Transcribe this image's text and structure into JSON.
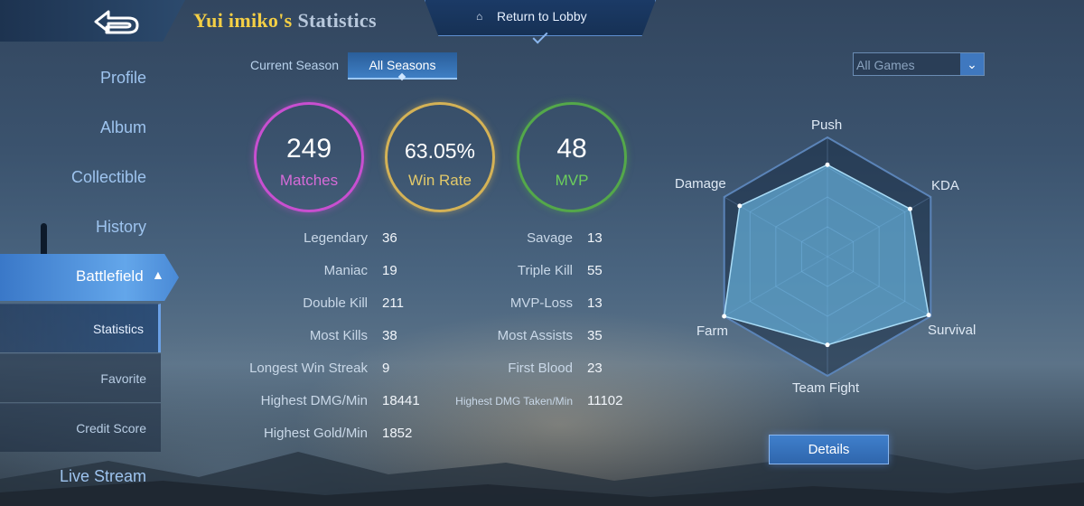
{
  "header": {
    "player_name": "Yui imiko's",
    "title_suffix": "Statistics",
    "lobby_label": "Return to Lobby"
  },
  "sidebar": {
    "items": [
      {
        "label": "Profile"
      },
      {
        "label": "Album"
      },
      {
        "label": "Collectible"
      },
      {
        "label": "History"
      },
      {
        "label": "Battlefield"
      },
      {
        "label": "Live Stream"
      }
    ],
    "sub_items": [
      {
        "label": "Statistics"
      },
      {
        "label": "Favorite"
      },
      {
        "label": "Credit Score"
      }
    ]
  },
  "tabs": {
    "current": "Current Season",
    "all": "All Seasons"
  },
  "filter": {
    "selected": "All Games"
  },
  "summary": {
    "matches": {
      "value": "249",
      "label": "Matches"
    },
    "win_rate": {
      "value": "63.05%",
      "label": "Win Rate"
    },
    "mvp": {
      "value": "48",
      "label": "MVP"
    }
  },
  "stats_left": [
    {
      "label": "Legendary",
      "value": "36"
    },
    {
      "label": "Maniac",
      "value": "19"
    },
    {
      "label": "Double Kill",
      "value": "211"
    },
    {
      "label": "Most Kills",
      "value": "38"
    },
    {
      "label": "Longest Win Streak",
      "value": "9"
    },
    {
      "label": "Highest DMG/Min",
      "value": "18441"
    },
    {
      "label": "Highest Gold/Min",
      "value": "1852"
    }
  ],
  "stats_right": [
    {
      "label": "Savage",
      "value": "13"
    },
    {
      "label": "Triple Kill",
      "value": "55"
    },
    {
      "label": "MVP-Loss",
      "value": "13"
    },
    {
      "label": "Most Assists",
      "value": "35"
    },
    {
      "label": "First Blood",
      "value": "23"
    },
    {
      "label": "Highest DMG Taken/Min",
      "value": "11102"
    }
  ],
  "radar": {
    "labels": {
      "push": "Push",
      "kda": "KDA",
      "survival": "Survival",
      "team_fight": "Team Fight",
      "farm": "Farm",
      "damage": "Damage"
    },
    "levels": {
      "push": 0.77,
      "kda": 0.8,
      "survival": 0.98,
      "team_fight": 0.74,
      "farm": 1.0,
      "damage": 0.85
    }
  },
  "details_label": "Details",
  "colors": {
    "matches": "#c84fd0",
    "win_rate": "#d4b256",
    "mvp": "#54a84a",
    "accent": "#3f7fc4",
    "name": "#f4cf45"
  }
}
